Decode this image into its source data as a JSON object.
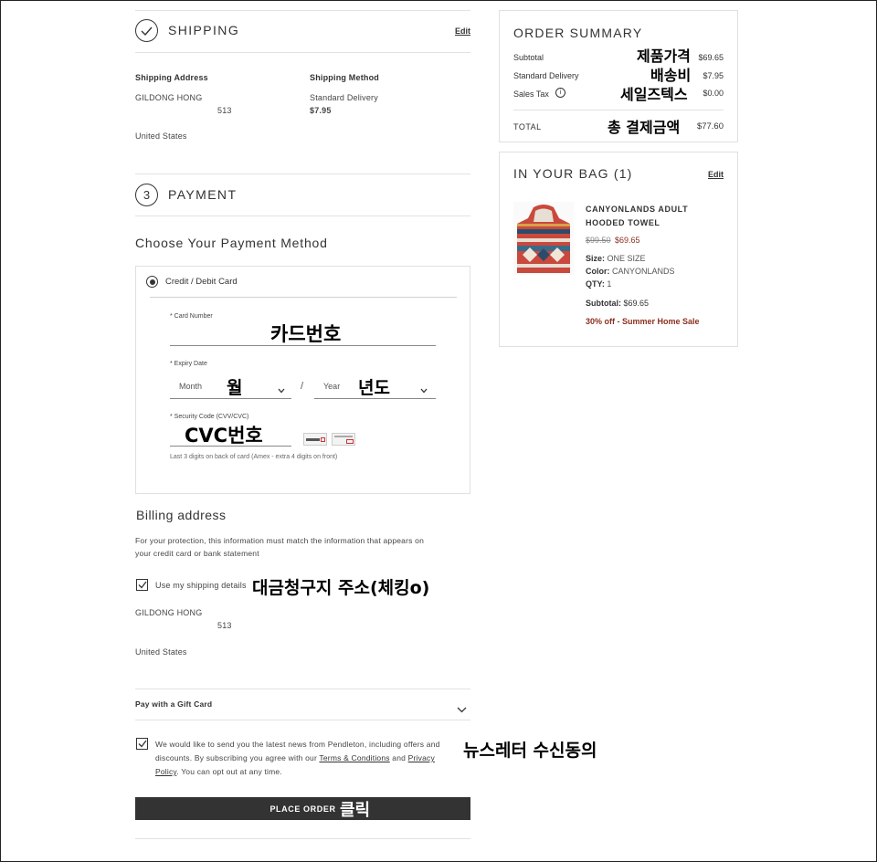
{
  "shipping": {
    "step_title": "SHIPPING",
    "edit_label": "Edit",
    "address_label": "Shipping Address",
    "name": "GILDONG HONG",
    "address_line": "513",
    "country": "United States",
    "method_label": "Shipping Method",
    "method_name": "Standard Delivery",
    "method_price": "$7.95"
  },
  "payment": {
    "step_number": "3",
    "step_title": "PAYMENT",
    "choose_heading": "Choose Your Payment Method",
    "option_label": "Credit / Debit Card",
    "card_number_label": "* Card Number",
    "expiry_label": "* Expiry Date",
    "month_placeholder": "Month",
    "year_placeholder": "Year",
    "separator": "/",
    "security_label": "* Security Code (CVV/CVC)",
    "security_hint": "Last 3 digits on back of card (Amex - extra 4 digits on front)"
  },
  "billing": {
    "heading": "Billing address",
    "note_line1": "For your protection, this information must match the information that appears on",
    "note_line2": "your credit card or bank statement",
    "use_shipping_label": "Use my shipping details",
    "use_shipping_checked": true,
    "name": "GILDONG HONG",
    "address_line": "513",
    "country": "United States"
  },
  "gift_card": {
    "label": "Pay with a Gift Card"
  },
  "newsletter": {
    "checked": true,
    "text_line1": "We would like to send you the latest news from Pendleton, including offers and",
    "text_line2_pre": "discounts. By subscribing you agree with our ",
    "terms_link": "Terms & Conditions",
    "and": " and ",
    "privacy_link_1": "Privacy",
    "privacy_link_2": "Policy",
    "text_line3_post": ". You can opt out at any time."
  },
  "place_order": {
    "label": "PLACE ORDER"
  },
  "order_summary": {
    "title": "ORDER SUMMARY",
    "subtotal_label": "Subtotal",
    "subtotal_value": "$69.65",
    "delivery_label": "Standard Delivery",
    "delivery_value": "$7.95",
    "tax_label": "Sales Tax",
    "tax_value": "$0.00",
    "total_label": "TOTAL",
    "total_value": "$77.60"
  },
  "bag": {
    "title": "IN YOUR BAG (1)",
    "edit_label": "Edit",
    "item": {
      "name_line1": "CANYONLANDS ADULT",
      "name_line2": "HOODED TOWEL",
      "original_price": "$99.50",
      "sale_price": "$69.65",
      "size_label": "Size:",
      "size_value": "ONE SIZE",
      "color_label": "Color:",
      "color_value": "CANYONLANDS",
      "qty_label": "QTY:",
      "qty_value": "1",
      "subtotal_label": "Subtotal:",
      "subtotal_value": "$69.65",
      "promo": "30% off - Summer Home Sale"
    }
  },
  "annotations": {
    "card_number": "카드번호",
    "month": "월",
    "year": "년도",
    "cvc": "CVC번호",
    "billing": "대금청구지 주소(체킹o)",
    "newsletter": "뉴스레터 수신동의",
    "click": "클릭",
    "product_price": "제품가격",
    "shipping_fee": "배송비",
    "sales_tax": "세일즈텍스",
    "total": "총 결제금액"
  },
  "colors": {
    "accent": "#8b2e1f",
    "button": "#333333",
    "border": "#e0e0e0"
  }
}
